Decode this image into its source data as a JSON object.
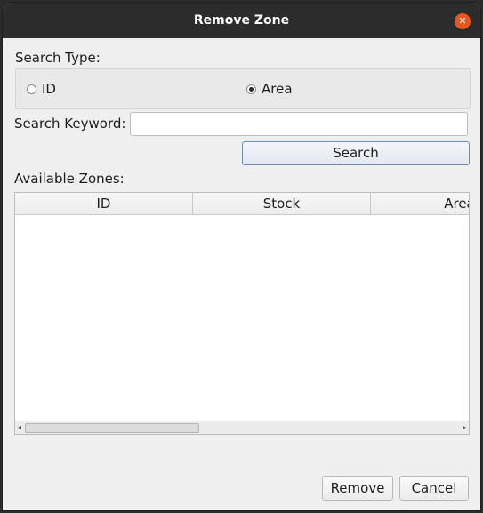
{
  "window": {
    "title": "Remove Zone",
    "close_glyph": "✕"
  },
  "search_type": {
    "label": "Search Type:",
    "options": [
      {
        "label": "ID",
        "checked": false
      },
      {
        "label": "Area",
        "checked": true
      }
    ]
  },
  "search_keyword": {
    "label": "Search Keyword:",
    "value": "",
    "placeholder": ""
  },
  "search_button": {
    "label": "Search"
  },
  "zones": {
    "label": "Available Zones:",
    "columns": [
      "ID",
      "Stock",
      "Area"
    ],
    "rows": []
  },
  "actions": {
    "remove_label": "Remove",
    "cancel_label": "Cancel"
  },
  "colors": {
    "close_button": "#e9541f",
    "titlebar": "#2c2c2c",
    "search_border": "#6f8db5"
  }
}
